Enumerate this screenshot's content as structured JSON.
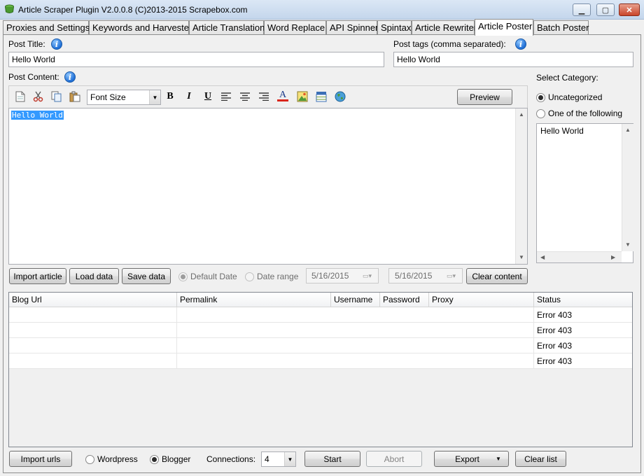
{
  "window": {
    "title": "Article Scraper Plugin V2.0.0.8 (C)2013-2015 Scrapebox.com",
    "minimize_glyph": "▁",
    "maximize_glyph": "▢",
    "close_glyph": "✕"
  },
  "tabs": [
    {
      "label": "Proxies and Settings",
      "active": false
    },
    {
      "label": "Keywords and Harvester",
      "active": false
    },
    {
      "label": "Article Translation",
      "active": false
    },
    {
      "label": "Word Replace",
      "active": false
    },
    {
      "label": "API Spinner",
      "active": false
    },
    {
      "label": "Spintax",
      "active": false
    },
    {
      "label": "Article Rewriter",
      "active": false
    },
    {
      "label": "Article Poster",
      "active": true
    },
    {
      "label": "Batch Poster",
      "active": false
    }
  ],
  "post": {
    "title_label": "Post Title:",
    "title_value": "Hello World",
    "tags_label": "Post tags (comma separated):",
    "tags_value": "Hello World",
    "content_label": "Post Content:",
    "content_value": "Hello World"
  },
  "toolbar": {
    "font_size_label": "Font Size",
    "bold": "B",
    "italic": "I",
    "underline": "U",
    "font_color": "A",
    "preview_label": "Preview",
    "icons": [
      "new-document-icon",
      "cut-icon",
      "copy-icon",
      "paste-icon",
      "bold-icon",
      "italic-icon",
      "underline-icon",
      "align-left-icon",
      "align-center-icon",
      "align-right-icon",
      "font-color-icon",
      "insert-image-icon",
      "insert-table-icon",
      "insert-link-icon"
    ]
  },
  "category": {
    "label": "Select Category:",
    "option_uncategorized": "Uncategorized",
    "option_following": "One of the following",
    "selected": "Uncategorized",
    "items": [
      "Hello World"
    ]
  },
  "actions": {
    "import_article": "Import article",
    "load_data": "Load data",
    "save_data": "Save data",
    "default_date": "Default Date",
    "date_range": "Date range",
    "date_from": "5/16/2015",
    "date_to": "5/16/2015",
    "clear_content": "Clear content"
  },
  "grid": {
    "columns": [
      "Blog Url",
      "Permalink",
      "Username",
      "Password",
      "Proxy",
      "Status"
    ],
    "rows": [
      {
        "blog_url": "",
        "permalink": "",
        "username": "",
        "password": "",
        "proxy": "",
        "status": "Error 403"
      },
      {
        "blog_url": "",
        "permalink": "",
        "username": "",
        "password": "",
        "proxy": "",
        "status": "Error 403"
      },
      {
        "blog_url": "",
        "permalink": "",
        "username": "",
        "password": "",
        "proxy": "",
        "status": "Error 403"
      },
      {
        "blog_url": "",
        "permalink": "",
        "username": "",
        "password": "",
        "proxy": "",
        "status": "Error 403"
      }
    ]
  },
  "bottom": {
    "import_urls": "Import urls",
    "platform_wordpress": "Wordpress",
    "platform_blogger": "Blogger",
    "selected_platform": "Blogger",
    "connections_label": "Connections:",
    "connections_value": "4",
    "start": "Start",
    "abort": "Abort",
    "export": "Export",
    "clear_list": "Clear list"
  },
  "colors": {
    "selection": "#3399ff",
    "info_icon": "#1f6fd6",
    "titlebar": "#c4d6ec"
  }
}
